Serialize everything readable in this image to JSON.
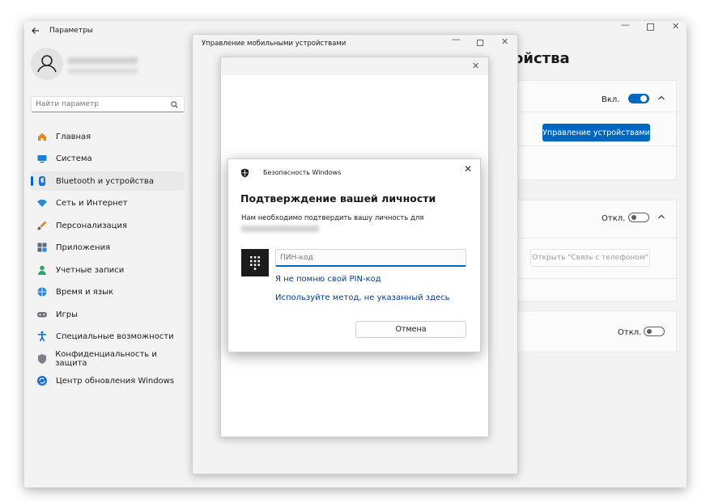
{
  "settings": {
    "app_title": "Параметры",
    "page_heading": "ойства",
    "search_placeholder": "Найти параметр",
    "nav": [
      {
        "label": "Главная",
        "icon": "home-icon"
      },
      {
        "label": "Система",
        "icon": "monitor-icon"
      },
      {
        "label": "Bluetooth и устройства",
        "icon": "bluetooth-icon"
      },
      {
        "label": "Сеть и Интернет",
        "icon": "wifi-icon"
      },
      {
        "label": "Персонализация",
        "icon": "brush-icon"
      },
      {
        "label": "Приложения",
        "icon": "apps-icon"
      },
      {
        "label": "Учетные записи",
        "icon": "user-icon"
      },
      {
        "label": "Время и язык",
        "icon": "globe-icon"
      },
      {
        "label": "Игры",
        "icon": "gamepad-icon"
      },
      {
        "label": "Специальные возможности",
        "icon": "accessibility-icon"
      },
      {
        "label": "Конфиденциальность и защита",
        "icon": "shield-icon"
      },
      {
        "label": "Центр обновления Windows",
        "icon": "update-icon"
      }
    ],
    "card1": {
      "toggle_label": "Вкл.",
      "manage_button": "Управление устройствами"
    },
    "card2": {
      "toggle_label": "Откл.",
      "open_button": "Открыть \"Связь с телефоном\""
    },
    "card3": {
      "toggle_label": "Откл."
    },
    "colors": {
      "accent": "#0067c0"
    }
  },
  "device_window": {
    "title": "Управление мобильными устройствами"
  },
  "security_dialog": {
    "app_name": "Безопасность Windows",
    "heading": "Подтверждение вашей личности",
    "message": "Нам необходимо подтвердить вашу личность для",
    "pin_placeholder": "ПИН-код",
    "forgot_pin_link": "Я не помню свой PIN-код",
    "other_method_link": "Используйте метод, не указанный здесь",
    "cancel_button": "Отмена"
  }
}
